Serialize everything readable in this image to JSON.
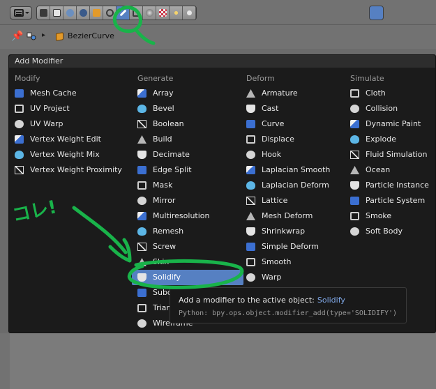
{
  "breadcrumb": {
    "object_name": "BezierCurve"
  },
  "menu": {
    "title": "Add Modifier",
    "columns": [
      {
        "heading": "Modify",
        "items": [
          "Mesh Cache",
          "UV Project",
          "UV Warp",
          "Vertex Weight Edit",
          "Vertex Weight Mix",
          "Vertex Weight Proximity"
        ]
      },
      {
        "heading": "Generate",
        "items": [
          "Array",
          "Bevel",
          "Boolean",
          "Build",
          "Decimate",
          "Edge Split",
          "Mask",
          "Mirror",
          "Multiresolution",
          "Remesh",
          "Screw",
          "Skin",
          "Solidify",
          "Subd",
          "Trian",
          "Wireframe"
        ]
      },
      {
        "heading": "Deform",
        "items": [
          "Armature",
          "Cast",
          "Curve",
          "Displace",
          "Hook",
          "Laplacian Smooth",
          "Laplacian Deform",
          "Lattice",
          "Mesh Deform",
          "Shrinkwrap",
          "Simple Deform",
          "Smooth",
          "Warp"
        ]
      },
      {
        "heading": "Simulate",
        "items": [
          "Cloth",
          "Collision",
          "Dynamic Paint",
          "Explode",
          "Fluid Simulation",
          "Ocean",
          "Particle Instance",
          "Particle System",
          "Smoke",
          "Soft Body"
        ]
      }
    ],
    "selected": "Solidify"
  },
  "tooltip": {
    "line1": "Add a modifier to the active object:",
    "op": "Solidify",
    "line2": "Python: bpy.ops.object.modifier_add(type='SOLIDIFY')"
  },
  "annotation": {
    "handwriting": "コレ!"
  },
  "colors": {
    "selection": "#5680c2",
    "annotation": "#19b34a",
    "menu_bg": "#181818"
  }
}
